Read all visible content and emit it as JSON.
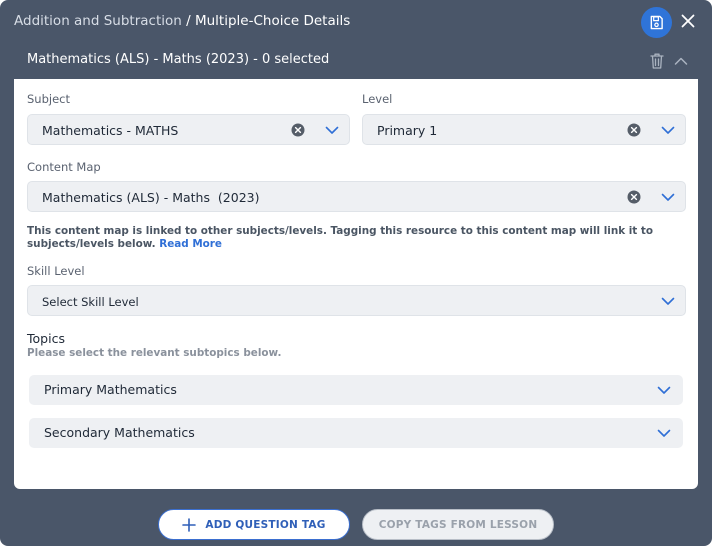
{
  "header": {
    "breadcrumb_parent": "Addition and Subtraction",
    "breadcrumb_separator": " / ",
    "breadcrumb_current": "Multiple-Choice Details",
    "save_icon": "save-icon",
    "close_icon": "close-icon",
    "accent_color": "#2f74d8"
  },
  "panel": {
    "title": "Mathematics (ALS) - Maths (2023) - 0 selected",
    "trash_icon": "trash-icon",
    "collapse_icon": "chevron-up-icon"
  },
  "form": {
    "subject": {
      "label": "Subject",
      "value": "Mathematics - MATHS"
    },
    "level": {
      "label": "Level",
      "value": "Primary 1"
    },
    "content_map": {
      "label": "Content Map",
      "value": "Mathematics (ALS) - Maths  (2023)"
    },
    "note": "This content map is linked to other subjects/levels. Tagging this resource to this content map will link it to subjects/levels below.",
    "note_link": "Read More",
    "skill_level": {
      "label": "Skill Level",
      "placeholder": "Select Skill Level"
    }
  },
  "topics": {
    "title": "Topics",
    "subtitle": "Please select the relevant subtopics below.",
    "items": [
      {
        "label": "Primary Mathematics"
      },
      {
        "label": "Secondary Mathematics"
      }
    ]
  },
  "footer": {
    "add_label": "ADD QUESTION TAG",
    "copy_label": "COPY TAGS FROM LESSON"
  }
}
